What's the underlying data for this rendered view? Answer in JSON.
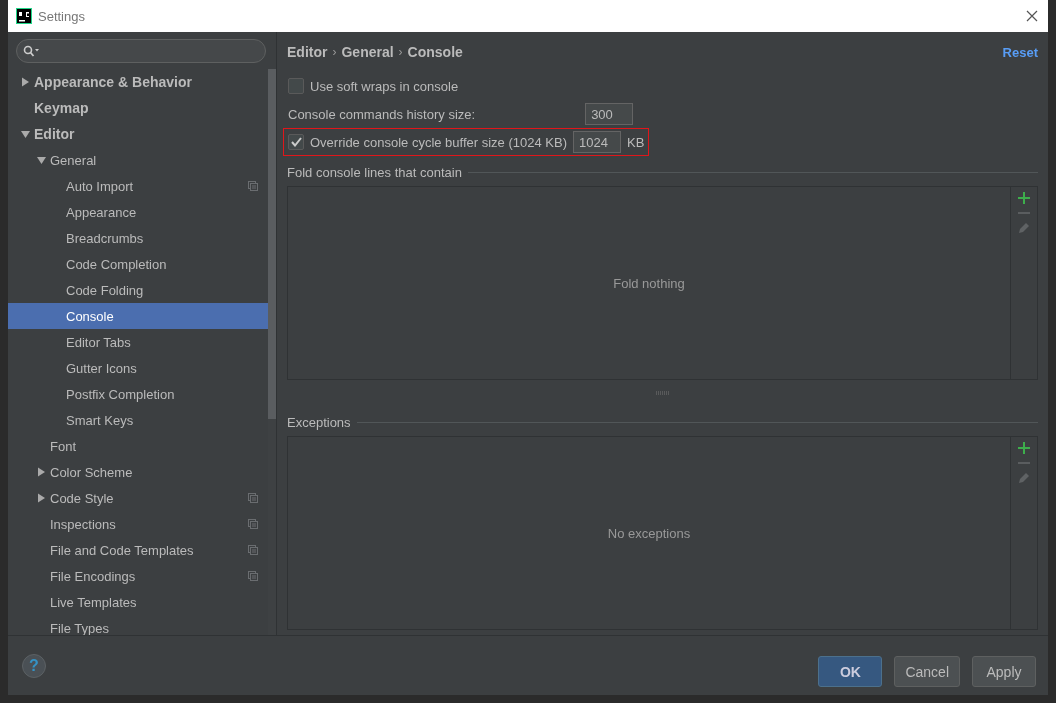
{
  "window": {
    "title": "Settings"
  },
  "tree": [
    {
      "label": "Appearance & Behavior",
      "expanded": false,
      "selected": false,
      "shared": false
    },
    {
      "label": "Keymap",
      "selected": false,
      "shared": false
    },
    {
      "label": "Editor",
      "expanded": true,
      "selected": false,
      "shared": false,
      "children": [
        {
          "label": "General",
          "expanded": true,
          "selected": false,
          "shared": false,
          "children": [
            {
              "label": "Auto Import",
              "selected": false,
              "shared": true
            },
            {
              "label": "Appearance",
              "selected": false,
              "shared": false
            },
            {
              "label": "Breadcrumbs",
              "selected": false,
              "shared": false
            },
            {
              "label": "Code Completion",
              "selected": false,
              "shared": false
            },
            {
              "label": "Code Folding",
              "selected": false,
              "shared": false
            },
            {
              "label": "Console",
              "selected": true,
              "shared": false
            },
            {
              "label": "Editor Tabs",
              "selected": false,
              "shared": false
            },
            {
              "label": "Gutter Icons",
              "selected": false,
              "shared": false
            },
            {
              "label": "Postfix Completion",
              "selected": false,
              "shared": false
            },
            {
              "label": "Smart Keys",
              "selected": false,
              "shared": false
            }
          ]
        },
        {
          "label": "Font",
          "selected": false,
          "shared": false
        },
        {
          "label": "Color Scheme",
          "expanded": false,
          "selected": false,
          "shared": false
        },
        {
          "label": "Code Style",
          "expanded": false,
          "selected": false,
          "shared": true
        },
        {
          "label": "Inspections",
          "selected": false,
          "shared": true
        },
        {
          "label": "File and Code Templates",
          "selected": false,
          "shared": true
        },
        {
          "label": "File Encodings",
          "selected": false,
          "shared": true
        },
        {
          "label": "Live Templates",
          "selected": false,
          "shared": false
        },
        {
          "label": "File Types",
          "selected": false,
          "shared": false
        }
      ]
    }
  ],
  "breadcrumb": [
    "Editor",
    "General",
    "Console"
  ],
  "breadcrumb_separator": "›",
  "reset": "Reset",
  "settings": [
    {
      "kind": "checkbox",
      "label": "Use soft wraps in console",
      "checked": false,
      "highlighted": false
    },
    {
      "kind": "number",
      "label": "Console commands history size:",
      "value": "300",
      "highlighted": false
    },
    {
      "kind": "checkbox_number",
      "label": "Override console cycle buffer size (1024 KB)",
      "checked": true,
      "value": "1024",
      "unit": "KB",
      "highlighted": true
    }
  ],
  "groups": [
    {
      "title": "Fold console lines that contain",
      "empty_text": "Fold nothing"
    },
    {
      "title": "Exceptions",
      "empty_text": "No exceptions"
    }
  ],
  "help": "?",
  "buttons": [
    {
      "label": "OK",
      "kind": "primary"
    },
    {
      "label": "Cancel",
      "kind": "normal"
    },
    {
      "label": "Apply",
      "kind": "normal"
    }
  ]
}
